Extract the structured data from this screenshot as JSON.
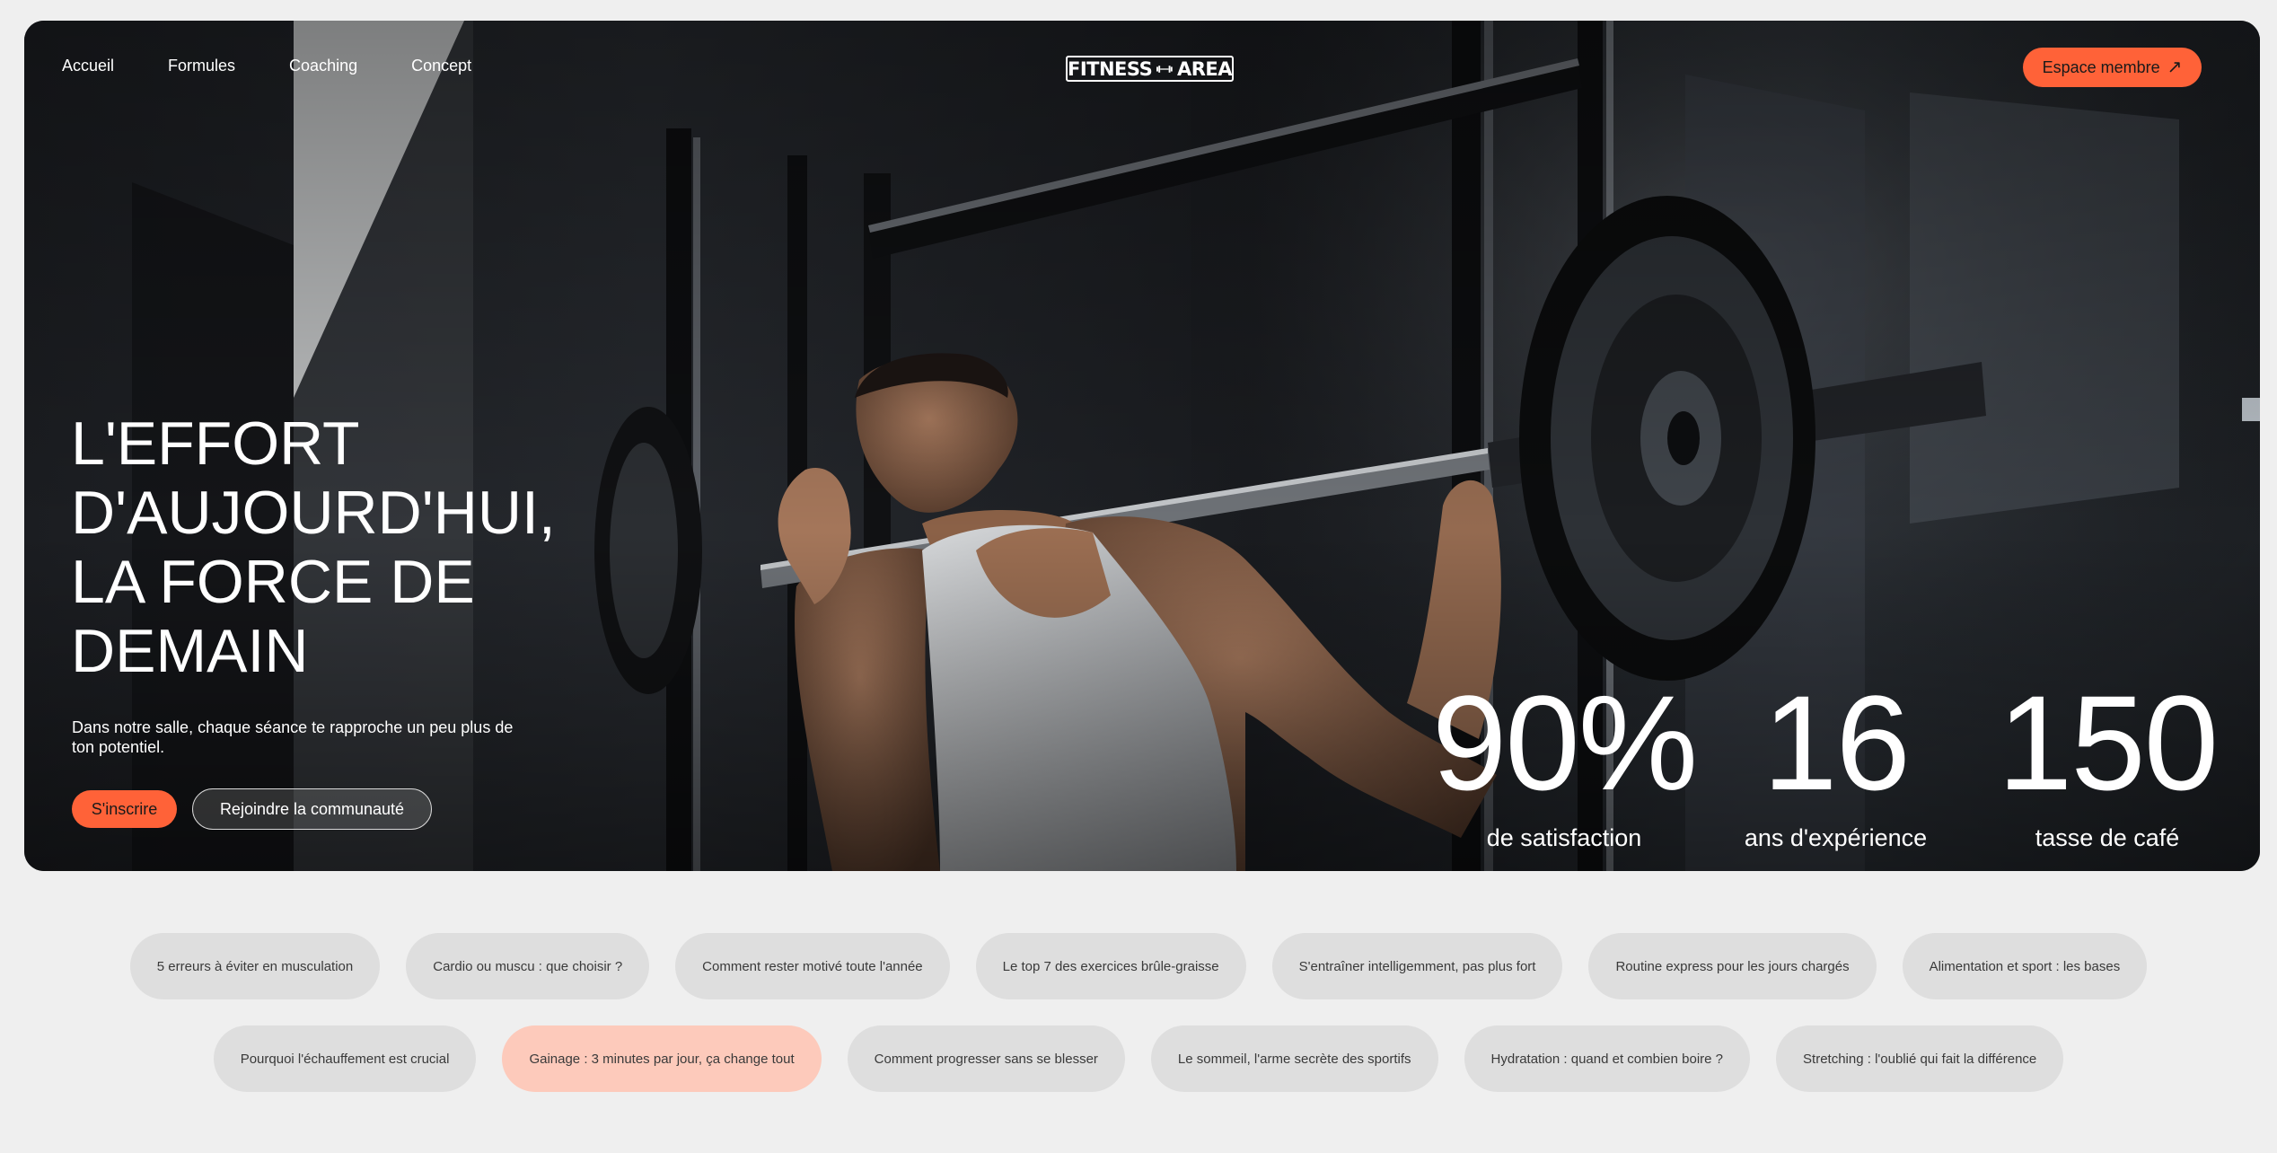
{
  "nav": {
    "links": [
      "Accueil",
      "Formules",
      "Coaching",
      "Concept"
    ],
    "logo_text": [
      "FITNESS",
      "AREA"
    ],
    "member_button": "Espace membre"
  },
  "hero": {
    "headline": [
      "L'EFFORT",
      "D'AUJOURD'HUI,",
      "LA FORCE DE",
      "DEMAIN"
    ],
    "subtitle": "Dans notre salle, chaque séance te rapproche un peu plus de ton potentiel.",
    "cta_primary": "S'inscrire",
    "cta_secondary": "Rejoindre la communauté",
    "stats": [
      {
        "value": "90%",
        "label": "de satisfaction"
      },
      {
        "value": "16",
        "label": "ans d'expérience"
      },
      {
        "value": "150",
        "label": "tasse de café"
      }
    ]
  },
  "tags": {
    "row1": [
      "5 erreurs à éviter en musculation",
      "Cardio ou muscu : que choisir ?",
      "Comment rester motivé toute l'année",
      "Le top 7 des exercices brûle-graisse",
      "S'entraîner intelligemment, pas plus fort",
      "Routine express pour les jours chargés",
      "Alimentation et sport : les bases"
    ],
    "row2": [
      "Pourquoi l'échauffement est crucial",
      "Gainage : 3 minutes par jour, ça change tout",
      "Comment progresser sans se blesser",
      "Le sommeil, l'arme secrète des sportifs",
      "Hydratation : quand et combien boire ?",
      "Stretching : l'oublié qui fait la différence"
    ],
    "active": "Gainage : 3 minutes par jour, ça change tout"
  },
  "icons": {
    "logo": "dumbbell-icon",
    "member_button": "arrow-up-right-icon"
  },
  "colors": {
    "accent": "#ff6238",
    "tag_active": "#fdcabb",
    "tag_default": "#dedede",
    "page_bg": "#efefef"
  }
}
